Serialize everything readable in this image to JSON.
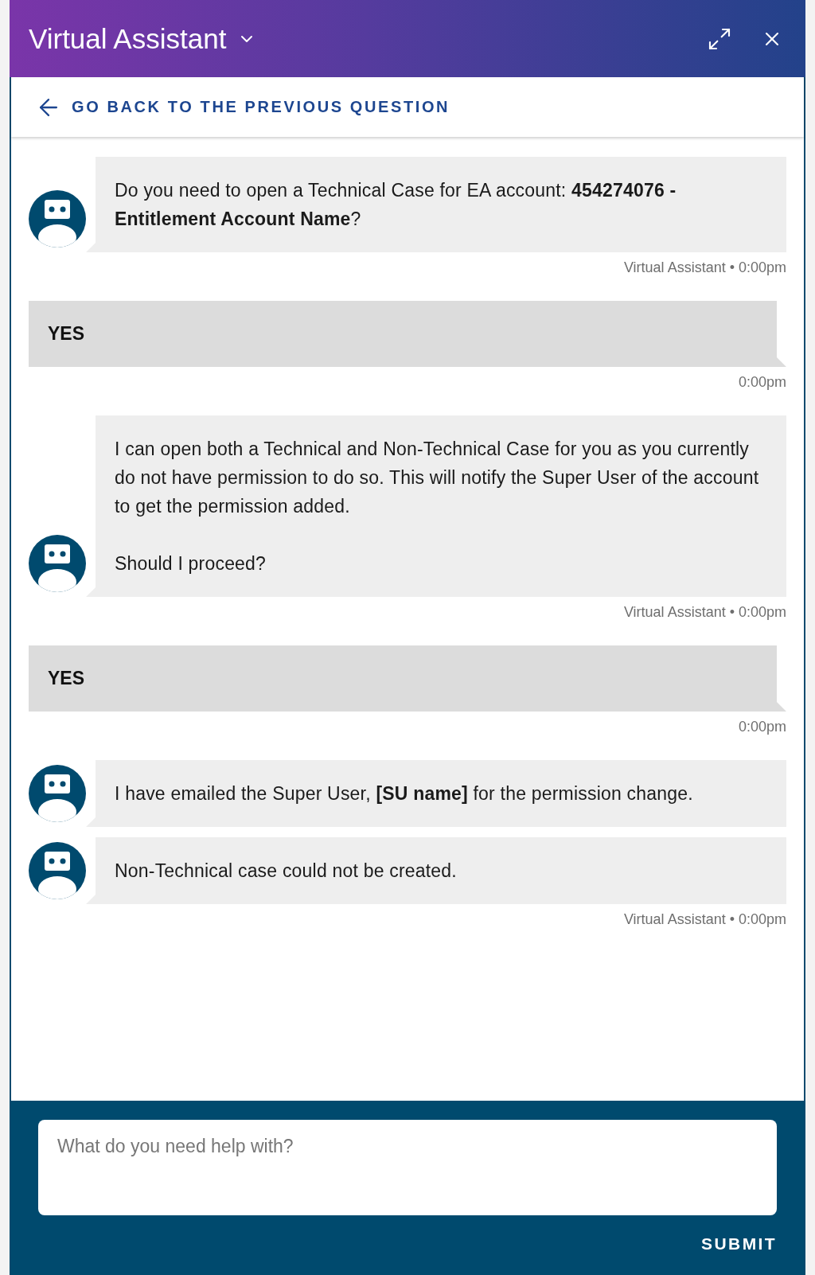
{
  "header": {
    "title": "Virtual Assistant"
  },
  "back_link": {
    "label": "GO BACK TO THE PREVIOUS QUESTION"
  },
  "messages": [
    {
      "kind": "bot",
      "bubbles": [
        "Do you need to open a Technical Case for EA account: **454274076 - Entitlement Account Name**?"
      ],
      "meta": "Virtual Assistant • 0:00pm"
    },
    {
      "kind": "user",
      "text": "YES",
      "meta": "0:00pm"
    },
    {
      "kind": "bot",
      "bubbles": [
        "I can open both a Technical and Non-Technical Case for you as you currently do not have permission to do so. This will notify the Super User of the account to get the permission added.\n\nShould I proceed?"
      ],
      "meta": "Virtual Assistant • 0:00pm"
    },
    {
      "kind": "user",
      "text": "YES",
      "meta": "0:00pm"
    },
    {
      "kind": "bot",
      "bubbles": [
        "I have emailed the Super User, **[SU name]** for the permission change.",
        "Non-Technical case could not be created."
      ],
      "meta": "Virtual Assistant • 0:00pm"
    }
  ],
  "composer": {
    "placeholder": "What do you need help with?",
    "submit": "SUBMIT"
  }
}
